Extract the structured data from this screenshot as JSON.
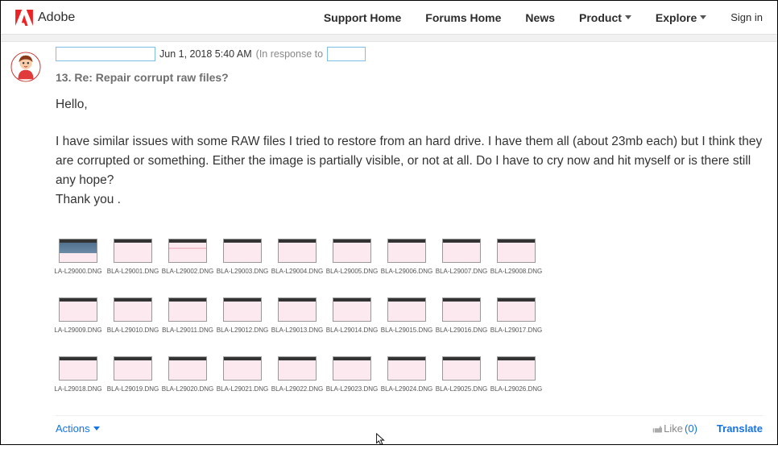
{
  "nav": {
    "brand": "Adobe",
    "items": [
      "Support Home",
      "Forums Home",
      "News",
      "Product",
      "Explore"
    ],
    "signin": "Sign in"
  },
  "post": {
    "date": "Jun 1, 2018 5:40 AM",
    "in_response_prefix": "(In response to",
    "title": "13. Re: Repair corrupt raw files?",
    "body_p1": "Hello,",
    "body_p2": "I have similar issues with some RAW files I tried to restore from an hard drive. I have them all (about 23mb each) but I think they are corrupted or something. Either the image is partially visible, or not at all. Do I have to cry now and hit myself or is there still any hope?",
    "body_p3": "Thank you ."
  },
  "thumbs": {
    "row1": [
      "LA-L29000.DNG",
      "BLA-L29001.DNG",
      "BLA-L29002.DNG",
      "BLA-L29003.DNG",
      "BLA-L29004.DNG",
      "BLA-L29005.DNG",
      "BLA-L29006.DNG",
      "BLA-L29007.DNG",
      "BLA-L29008.DNG"
    ],
    "row2": [
      "LA-L29009.DNG",
      "BLA-L29010.DNG",
      "BLA-L29011.DNG",
      "BLA-L29012.DNG",
      "BLA-L29013.DNG",
      "BLA-L29014.DNG",
      "BLA-L29015.DNG",
      "BLA-L29016.DNG",
      "BLA-L29017.DNG"
    ],
    "row3": [
      "LA-L29018.DNG",
      "BLA-L29019.DNG",
      "BLA-L29020.DNG",
      "BLA-L29021.DNG",
      "BLA-L29022.DNG",
      "BLA-L29023.DNG",
      "BLA-L29024.DNG",
      "BLA-L29025.DNG",
      "BLA-L29026.DNG"
    ]
  },
  "actions": {
    "actions_label": "Actions",
    "like_label": "Like",
    "like_count": "(0)",
    "translate_label": "Translate"
  }
}
